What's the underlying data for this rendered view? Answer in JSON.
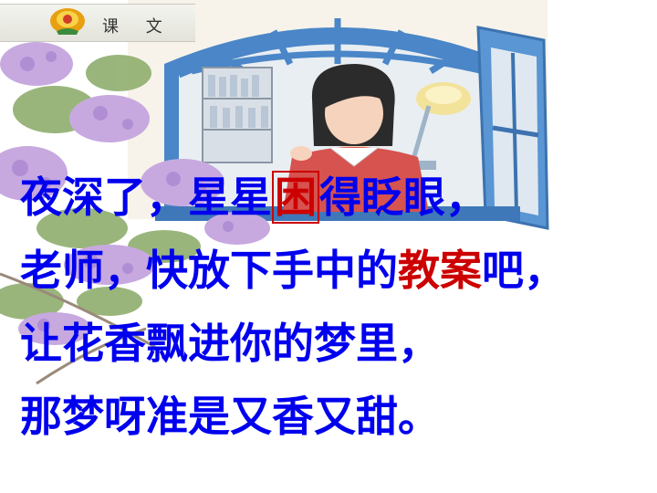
{
  "header": {
    "lesson_label": "课 文"
  },
  "poem": {
    "line1": {
      "before": "夜深了，星星",
      "highlight": "困",
      "after": "得眨眼，"
    },
    "line2": {
      "before": "老师，快放下手中的",
      "highlight": "教案",
      "after": "吧，"
    },
    "line3": {
      "text": "让花香飘进你的梦里，"
    },
    "line4": {
      "text": "那梦呀准是又香又甜。"
    }
  },
  "colors": {
    "poem_text": "#0000ee",
    "highlight": "#cc0000"
  },
  "illustration": {
    "icons": [
      "flower-icon",
      "window-illustration",
      "teacher-illustration",
      "lilac-flowers-illustration",
      "desk-lamp-illustration",
      "bookshelf-illustration"
    ]
  }
}
